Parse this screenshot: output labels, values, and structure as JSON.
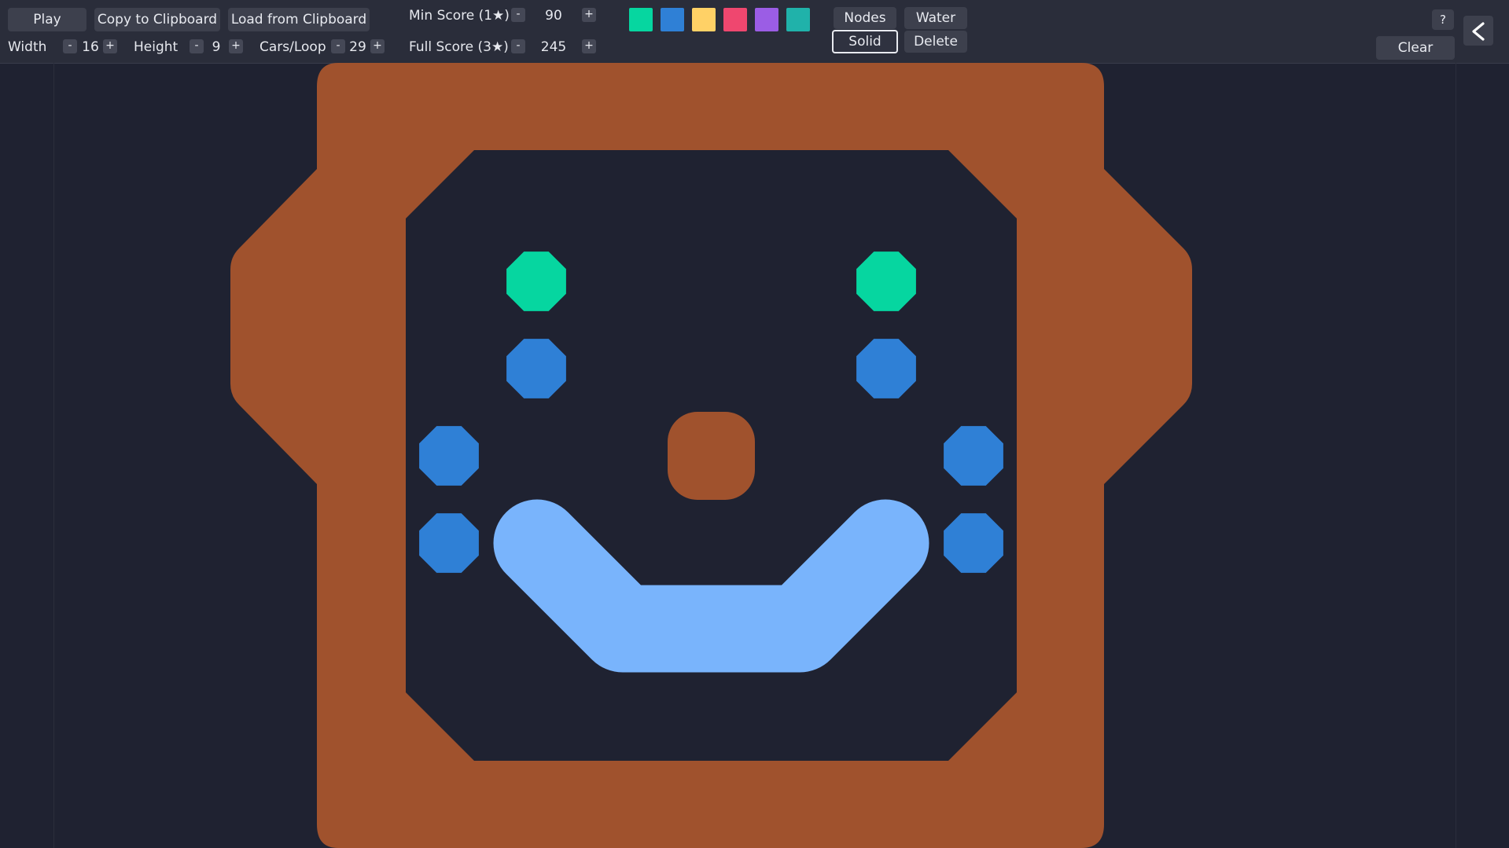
{
  "toolbar": {
    "play_label": "Play",
    "copy_label": "Copy to Clipboard",
    "load_label": "Load from Clipboard",
    "width_label": "Width",
    "width_value": "16",
    "height_label": "Height",
    "height_value": "9",
    "cars_label": "Cars/Loop",
    "cars_value": "29",
    "min_score_label": "Min Score (1★)",
    "min_score_value": "90",
    "full_score_label": "Full Score (3★)",
    "full_score_value": "245",
    "minus": "-",
    "plus": "+",
    "swatches": [
      "#06d6a0",
      "#2f80d6",
      "#ffd166",
      "#ef476f",
      "#9b5de5",
      "#20b2aa"
    ],
    "nodes_label": "Nodes",
    "water_label": "Water",
    "solid_label": "Solid",
    "delete_label": "Delete",
    "help_label": "?",
    "clear_label": "Clear",
    "back_icon": "chevron-left-icon"
  },
  "colors": {
    "background": "#1f2231",
    "toolbar": "#2a2d3a",
    "solid": "#a0522d",
    "water": "#79b4fc",
    "node_green": "#06d6a0",
    "node_blue": "#2f80d6"
  }
}
